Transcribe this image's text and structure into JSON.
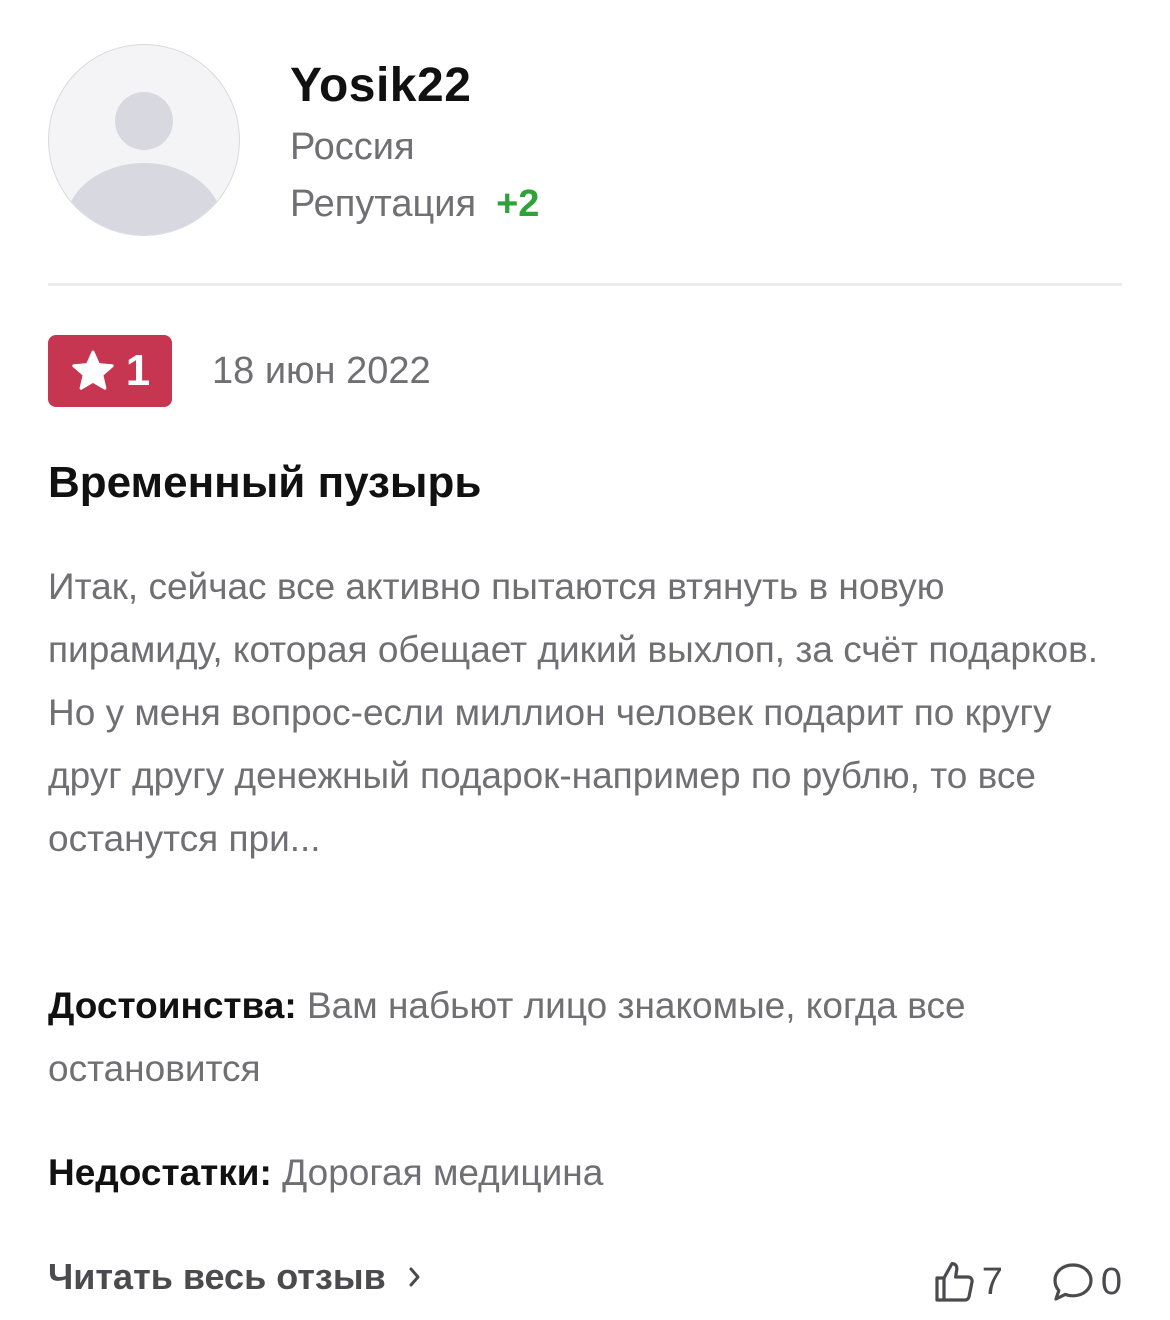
{
  "author": {
    "name": "Yosik22",
    "country": "Россия",
    "reputation_label": "Репутация",
    "reputation_value": "+2"
  },
  "review": {
    "rating": "1",
    "date": "18 июн 2022",
    "title": "Временный пузырь",
    "text": "Итак, сейчас все активно пытаются втянуть в новую пирамиду, которая обещает дикий выхлоп, за счёт подарков. Но у меня вопрос-если миллион человек подарит по кругу друг другу денежный подарок-например по рублю, то все останутся при...",
    "pros_label": "Достоинства:",
    "pros_text": "Вам набьют лицо знакомые, когда все остановится",
    "cons_label": "Недостатки:",
    "cons_text": "Дорогая медицина"
  },
  "footer": {
    "read_more_label": "Читать весь отзыв",
    "likes": "7",
    "comments": "0"
  },
  "colors": {
    "rating_badge": "#c73650",
    "reputation_positive": "#2fa23a",
    "primary_text": "#111111",
    "secondary_text": "#6f6f74"
  },
  "icons": {
    "avatar": "default-user-avatar",
    "rating": "star-icon",
    "read_more": "chevron-right-icon",
    "likes": "thumbs-up-icon",
    "comments": "comment-bubble-icon"
  }
}
